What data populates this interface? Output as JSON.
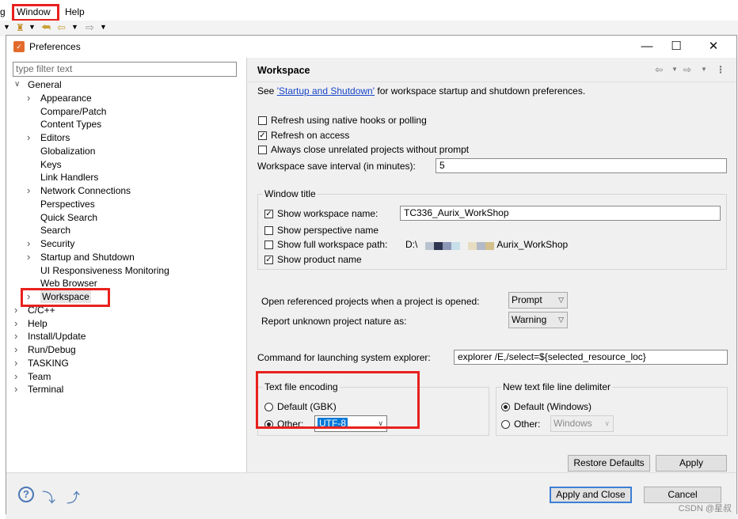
{
  "ide": {
    "menu": [
      "g",
      "Window",
      "Help"
    ]
  },
  "dialog": {
    "title": "Preferences",
    "filter_placeholder": "type filter text",
    "tree": [
      {
        "label": "General",
        "level": 0,
        "expanded": true
      },
      {
        "label": "Appearance",
        "level": 1,
        "has_children": true
      },
      {
        "label": "Compare/Patch",
        "level": 1
      },
      {
        "label": "Content Types",
        "level": 1
      },
      {
        "label": "Editors",
        "level": 1,
        "has_children": true
      },
      {
        "label": "Globalization",
        "level": 1
      },
      {
        "label": "Keys",
        "level": 1
      },
      {
        "label": "Link Handlers",
        "level": 1
      },
      {
        "label": "Network Connections",
        "level": 1,
        "has_children": true
      },
      {
        "label": "Perspectives",
        "level": 1
      },
      {
        "label": "Quick Search",
        "level": 1
      },
      {
        "label": "Search",
        "level": 1
      },
      {
        "label": "Security",
        "level": 1,
        "has_children": true
      },
      {
        "label": "Startup and Shutdown",
        "level": 1,
        "has_children": true
      },
      {
        "label": "UI Responsiveness Monitoring",
        "level": 1
      },
      {
        "label": "Web Browser",
        "level": 1
      },
      {
        "label": "Workspace",
        "level": 1,
        "has_children": true,
        "selected": true
      },
      {
        "label": "C/C++",
        "level": 0,
        "has_children": true
      },
      {
        "label": "Help",
        "level": 0,
        "has_children": true
      },
      {
        "label": "Install/Update",
        "level": 0,
        "has_children": true
      },
      {
        "label": "Run/Debug",
        "level": 0,
        "has_children": true
      },
      {
        "label": "TASKING",
        "level": 0,
        "has_children": true
      },
      {
        "label": "Team",
        "level": 0,
        "has_children": true
      },
      {
        "label": "Terminal",
        "level": 0,
        "has_children": true
      }
    ],
    "page": {
      "title": "Workspace",
      "see_prefix": "See ",
      "see_link": "'Startup and Shutdown'",
      "see_suffix": " for workspace startup and shutdown preferences.",
      "refresh_native": {
        "label": "Refresh using native hooks or polling",
        "checked": false
      },
      "refresh_access": {
        "label": "Refresh on access",
        "checked": true
      },
      "always_close": {
        "label": "Always close unrelated projects without prompt",
        "checked": false
      },
      "save_interval_label": "Workspace save interval (in minutes):",
      "save_interval_value": "5",
      "window_title": {
        "group_label": "Window title",
        "show_workspace_name": {
          "label": "Show workspace name:",
          "checked": true,
          "value": "TC336_Aurix_WorkShop"
        },
        "show_perspective_name": {
          "label": "Show perspective name",
          "checked": false
        },
        "show_full_path": {
          "label": "Show full workspace path:",
          "checked": false,
          "path_prefix": "D:\\",
          "path_suffix": "Aurix_WorkShop"
        },
        "show_product_name": {
          "label": "Show product name",
          "checked": true
        }
      },
      "open_referenced_label": "Open referenced projects when a project is opened:",
      "open_referenced_value": "Prompt",
      "report_unknown_label": "Report unknown project nature as:",
      "report_unknown_value": "Warning",
      "command_label": "Command for launching system explorer:",
      "command_value": "explorer /E,/select=${selected_resource_loc}",
      "encoding": {
        "group_label": "Text file encoding",
        "default_label": "Default (GBK)",
        "other_label": "Other:",
        "other_value": "UTF-8",
        "selected": "other"
      },
      "line_delimiter": {
        "group_label": "New text file line delimiter",
        "default_label": "Default (Windows)",
        "other_label": "Other:",
        "other_value": "Windows",
        "selected": "default"
      },
      "restore_defaults": "Restore Defaults",
      "apply": "Apply"
    },
    "footer": {
      "apply_and_close": "Apply and Close",
      "cancel": "Cancel"
    }
  },
  "watermark": "CSDN @星叔",
  "colors": {
    "highlight_box": "#e8211d",
    "link": "#1a47c8",
    "selection": "#0078d7"
  }
}
